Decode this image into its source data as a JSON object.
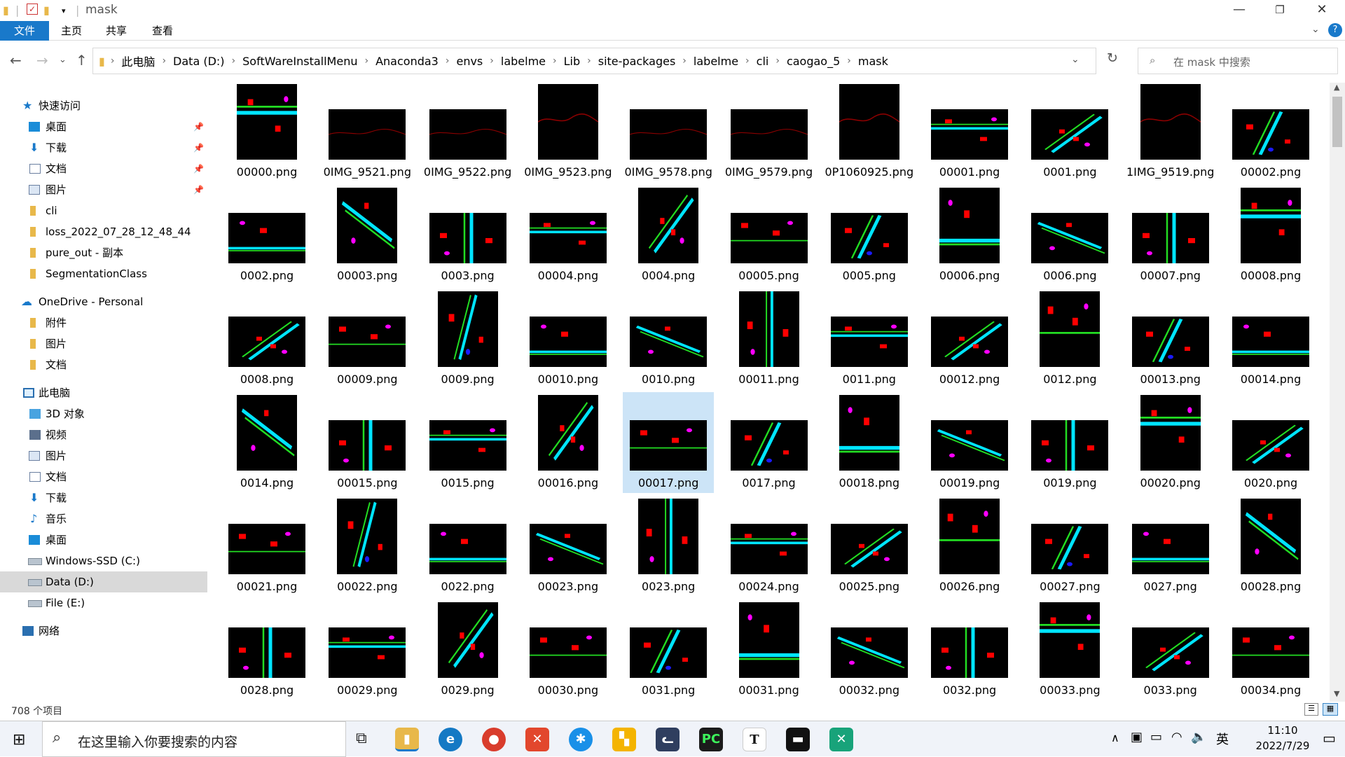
{
  "window": {
    "title": "mask",
    "controls": [
      "minimize",
      "maximize",
      "close"
    ]
  },
  "ribbon": {
    "tabs": [
      "文件",
      "主页",
      "共享",
      "查看"
    ]
  },
  "address": {
    "crumbs": [
      "此电脑",
      "Data (D:)",
      "SoftWareInstallMenu",
      "Anaconda3",
      "envs",
      "labelme",
      "Lib",
      "site-packages",
      "labelme",
      "cli",
      "caogao_5",
      "mask"
    ],
    "search_placeholder": "在 mask 中搜索"
  },
  "nav": {
    "quick_access": "快速访问",
    "quick_items": [
      "桌面",
      "下载",
      "文档",
      "图片",
      "cli",
      "loss_2022_07_28_12_48_44",
      "pure_out - 副本",
      "SegmentationClass"
    ],
    "onedrive": "OneDrive - Personal",
    "onedrive_items": [
      "附件",
      "图片",
      "文档"
    ],
    "this_pc": "此电脑",
    "pc_items": [
      "3D 对象",
      "视频",
      "图片",
      "文档",
      "下载",
      "音乐",
      "桌面",
      "Windows-SSD (C:)",
      "Data (D:)",
      "File (E:)"
    ],
    "network": "网络"
  },
  "files": [
    "00000.png",
    "0IMG_9521.png",
    "0IMG_9522.png",
    "0IMG_9523.png",
    "0IMG_9578.png",
    "0IMG_9579.png",
    "0P1060925.png",
    "00001.png",
    "0001.png",
    "1IMG_9519.png",
    "00002.png",
    "0002.png",
    "00003.png",
    "0003.png",
    "00004.png",
    "0004.png",
    "00005.png",
    "0005.png",
    "00006.png",
    "0006.png",
    "00007.png",
    "00008.png",
    "0008.png",
    "00009.png",
    "0009.png",
    "00010.png",
    "0010.png",
    "00011.png",
    "0011.png",
    "00012.png",
    "0012.png",
    "00013.png",
    "00014.png",
    "0014.png",
    "00015.png",
    "0015.png",
    "00016.png",
    "00017.png",
    "0017.png",
    "00018.png",
    "00019.png",
    "0019.png",
    "00020.png",
    "0020.png",
    "00021.png",
    "00022.png",
    "0022.png",
    "00023.png",
    "0023.png",
    "00024.png",
    "00025.png",
    "00026.png",
    "00027.png",
    "0027.png",
    "00028.png",
    "0028.png",
    "00029.png",
    "0029.png",
    "00030.png",
    "0031.png",
    "00031.png",
    "00032.png",
    "0032.png",
    "00033.png",
    "0033.png",
    "00034.png"
  ],
  "selected_file": "00017.png",
  "status": {
    "count": "708 个项目"
  },
  "taskbar": {
    "search_placeholder": "在这里输入你要搜索的内容",
    "ime": "英",
    "time": "11:10",
    "date": "2022/7/29"
  }
}
